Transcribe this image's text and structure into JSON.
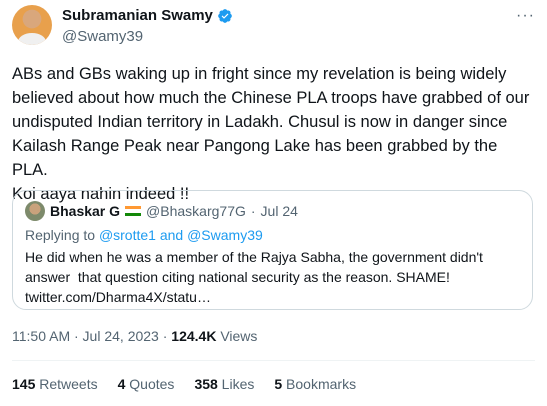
{
  "author": {
    "name": "Subramanian Swamy",
    "handle": "@Swamy39"
  },
  "more_icon": "more-dots-icon",
  "tweet_text": "ABs and GBs waking up in fright since my revelation is being widely\nbelieved about how much the Chinese PLA troops have grabbed of our\nundisputed Indian territory in Ladakh. Chusul is now in danger since\nKailash Range Peak near Pangong Lake has been grabbed by the PLA.\nKoi aaya nahin indeed !!",
  "quote": {
    "name": "Bhaskar G",
    "handle": "@Bhaskarg77G",
    "separator": "·",
    "date": "Jul 24",
    "reply_prefix": "Replying to ",
    "reply_to": "@srotte1 and @Swamy39",
    "body": "He did when he was a member of the Rajya Sabha, the government didn't\nanswer  that question citing national security as the reason. SHAME!\ntwitter.com/Dharma4X/statu…"
  },
  "meta": {
    "time_date": "11:50 AM · Jul 24, 2023 · ",
    "views_count": "124.4K",
    "views_label": " Views"
  },
  "stats": {
    "retweets_count": "145",
    "retweets_label": " Retweets",
    "quotes_count": "4",
    "quotes_label": " Quotes",
    "likes_count": "358",
    "likes_label": " Likes",
    "bookmarks_count": "5",
    "bookmarks_label": " Bookmarks"
  },
  "colors": {
    "verified_blue": "#1d9bf0",
    "muted_text": "#536471",
    "border": "#cfd9de"
  }
}
